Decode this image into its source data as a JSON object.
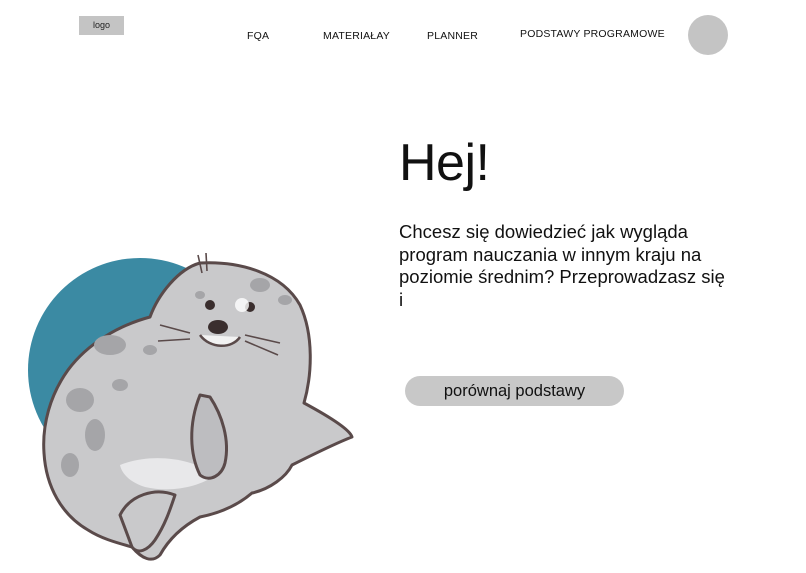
{
  "header": {
    "logo_label": "logo",
    "nav": [
      {
        "label": "FQA"
      },
      {
        "label": "MATERIAŁAY"
      },
      {
        "label": "PLANNER"
      },
      {
        "label": "PODSTAWY PROGRAMOWE"
      }
    ]
  },
  "hero": {
    "title": "Hej!",
    "text": "Chcesz się dowiedzieć jak wygląda program nauczania w innym kraju na poziomie średnim? Przeprowadzasz się i",
    "button_label": "porównaj podstawy"
  },
  "colors": {
    "placeholder_gray": "#c4c4c4",
    "button_gray": "#c8c8c8",
    "mascot_circle": "#3b8aa3",
    "seal_body": "#c9c9cb",
    "seal_spots": "#a5a5a8",
    "seal_outline": "#5a4a4a"
  }
}
